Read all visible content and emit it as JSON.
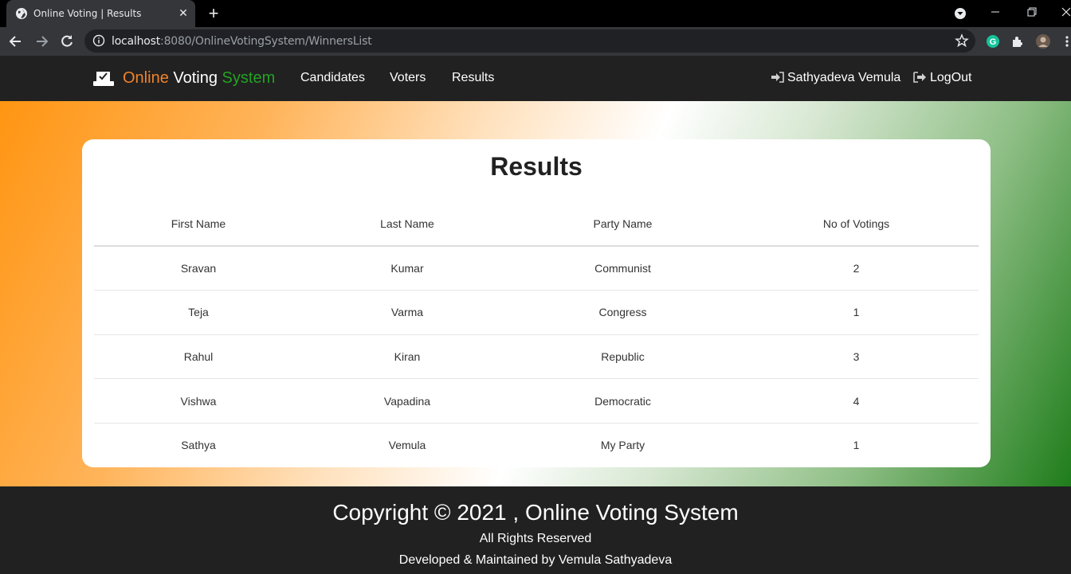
{
  "browser": {
    "tab_title": "Online Voting | Results",
    "url_host": "localhost",
    "url_rest": ":8080/OnlineVotingSystem/WinnersList"
  },
  "navbar": {
    "brand": [
      "Online",
      "Voting",
      "System"
    ],
    "links": [
      "Candidates",
      "Voters",
      "Results"
    ],
    "user": "Sathyadeva Vemula",
    "logout": "LogOut"
  },
  "results": {
    "title": "Results",
    "columns": [
      "First Name",
      "Last Name",
      "Party Name",
      "No of Votings"
    ],
    "rows": [
      [
        "Sravan",
        "Kumar",
        "Communist",
        "2"
      ],
      [
        "Teja",
        "Varma",
        "Congress",
        "1"
      ],
      [
        "Rahul",
        "Kiran",
        "Republic",
        "3"
      ],
      [
        "Vishwa",
        "Vapadina",
        "Democratic",
        "4"
      ],
      [
        "Sathya",
        "Vemula",
        "My Party",
        "1"
      ]
    ]
  },
  "footer": {
    "copyright": "Copyright © 2021 , Online Voting System",
    "rights": "All Rights Reserved",
    "developer": "Developed & Maintained by Vemula Sathyadeva"
  },
  "colors": {
    "brand_orange": "#f0832a",
    "brand_green": "#23a323",
    "navbar_bg": "#212121"
  }
}
